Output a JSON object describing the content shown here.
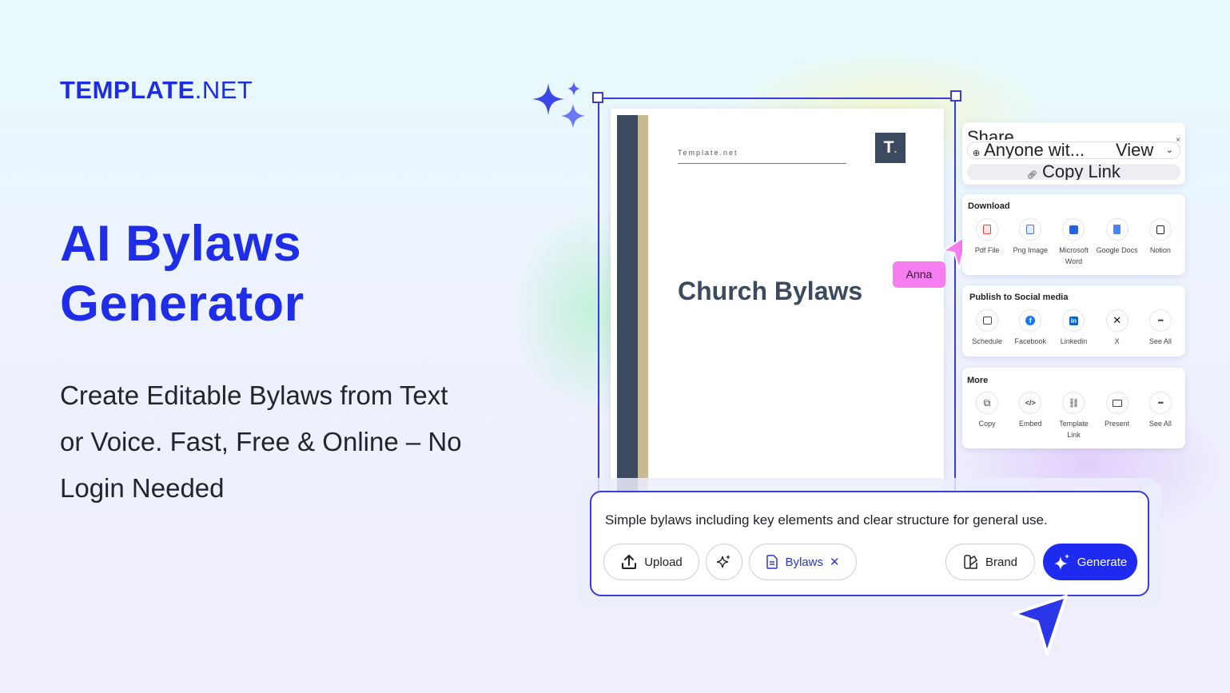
{
  "brand": {
    "logo_bold": "TEMPLATE",
    "logo_thin": ".NET"
  },
  "hero": {
    "title_line1": "AI Bylaws",
    "title_line2": "Generator",
    "subtitle_line1": "Create Editable Bylaws from Text",
    "subtitle_line2": "or Voice. Fast, Free & Online – No",
    "subtitle_line3": "Login Needed"
  },
  "document": {
    "brand": "Template.net",
    "logo": "T",
    "title": "Church Bylaws"
  },
  "collaborator": {
    "name": "Anna"
  },
  "share_panel": {
    "title": "Share",
    "close": "×",
    "access": "Anyone wit...",
    "permission": "View",
    "copy_link": "Copy Link"
  },
  "download_panel": {
    "title": "Download",
    "items": [
      {
        "label": "Pdf File",
        "icon": "pdf-icon"
      },
      {
        "label": "Png Image",
        "icon": "png-icon"
      },
      {
        "label": "Microsoft Word",
        "icon": "word-icon"
      },
      {
        "label": "Google Docs",
        "icon": "google-docs-icon"
      },
      {
        "label": "Notion",
        "icon": "notion-icon"
      }
    ]
  },
  "social_panel": {
    "title": "Publish to Social media",
    "items": [
      {
        "label": "Schedule",
        "icon": "calendar-icon"
      },
      {
        "label": "Facebook",
        "icon": "facebook-icon"
      },
      {
        "label": "Linkedin",
        "icon": "linkedin-icon"
      },
      {
        "label": "X",
        "icon": "x-icon"
      },
      {
        "label": "See All",
        "icon": "more-icon"
      }
    ]
  },
  "more_panel": {
    "title": "More",
    "items": [
      {
        "label": "Copy",
        "icon": "copy-icon"
      },
      {
        "label": "Embed",
        "icon": "code-icon"
      },
      {
        "label": "Template Link",
        "icon": "link-icon"
      },
      {
        "label": "Present",
        "icon": "present-icon"
      },
      {
        "label": "See All",
        "icon": "more-icon"
      }
    ]
  },
  "prompt": {
    "text": "Simple bylaws including key elements and clear structure for general use.",
    "upload_label": "Upload",
    "tag_label": "Bylaws",
    "brand_label": "Brand",
    "generate_label": "Generate"
  },
  "colors": {
    "accent": "#1f2af0",
    "headline": "#1f2ee6",
    "doc_dark": "#3c4a60",
    "doc_tan": "#c8bb92",
    "collaborator": "#f77ef0"
  }
}
